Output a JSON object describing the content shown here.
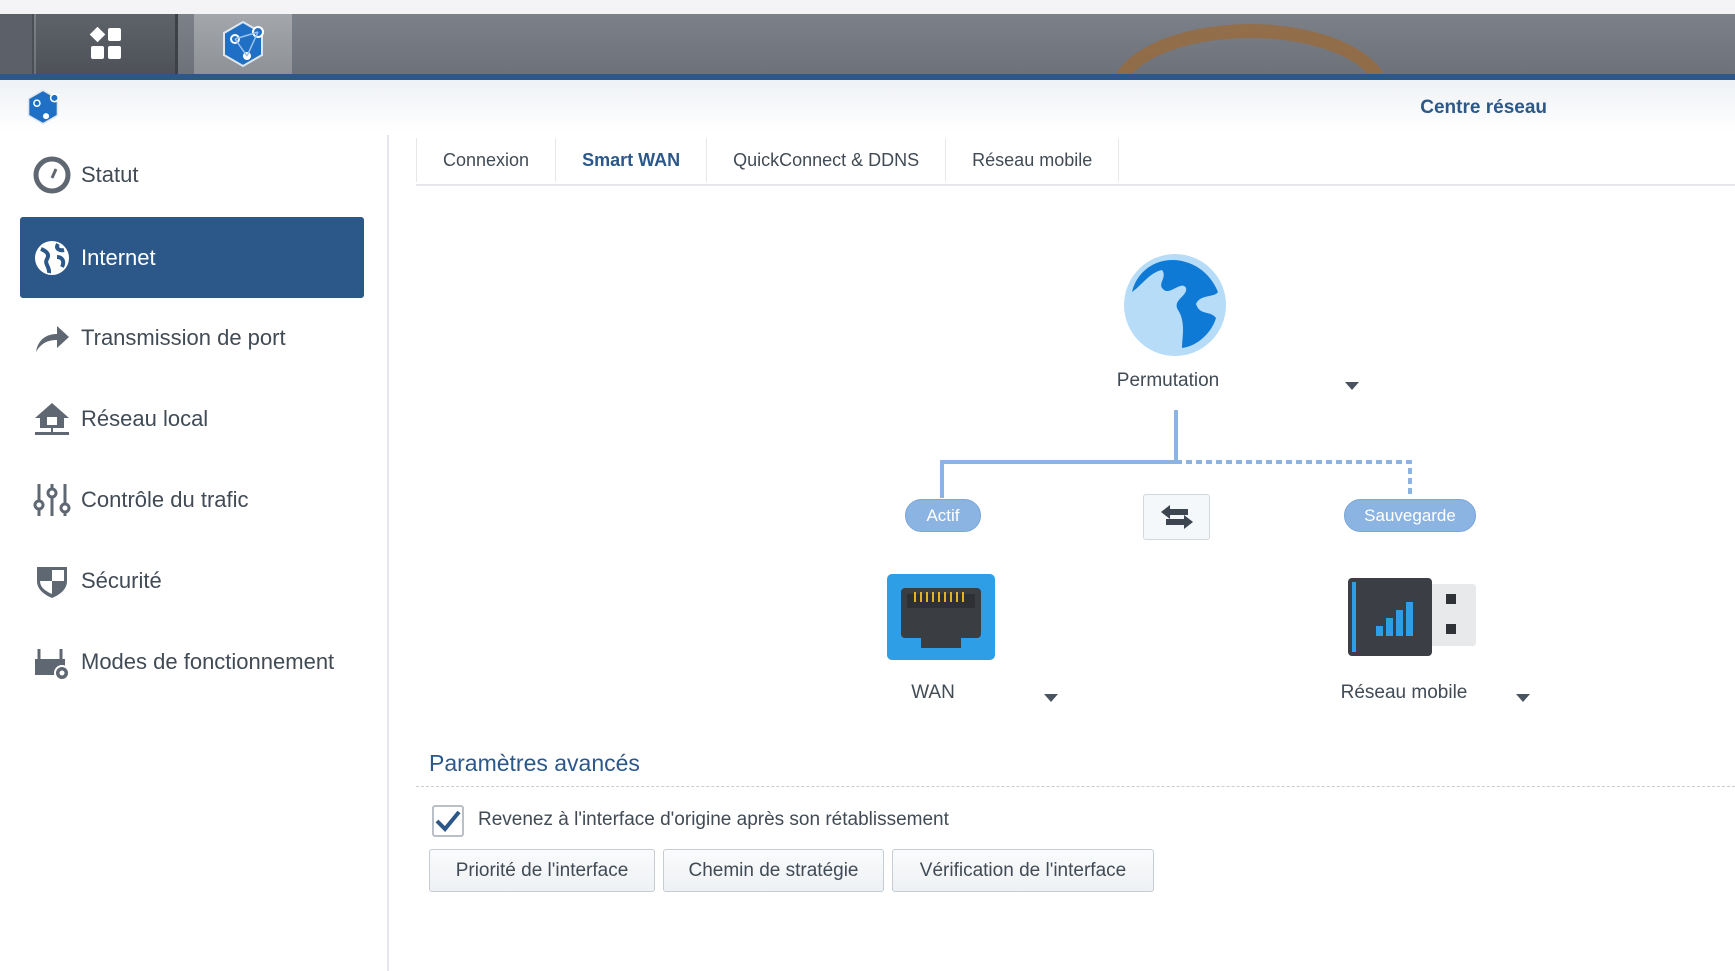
{
  "app": {
    "title": "Centre réseau"
  },
  "sidebar": {
    "items": [
      {
        "label": "Statut",
        "icon": "gauge-icon"
      },
      {
        "label": "Internet",
        "icon": "globe-icon",
        "active": true
      },
      {
        "label": "Transmission de port",
        "icon": "forward-arrow-icon"
      },
      {
        "label": "Réseau local",
        "icon": "home-network-icon"
      },
      {
        "label": "Contrôle du trafic",
        "icon": "sliders-icon"
      },
      {
        "label": "Sécurité",
        "icon": "shield-icon"
      },
      {
        "label": "Modes de fonctionnement",
        "icon": "router-gear-icon"
      }
    ]
  },
  "tabs": [
    {
      "label": "Connexion"
    },
    {
      "label": "Smart WAN",
      "active": true
    },
    {
      "label": "QuickConnect & DDNS"
    },
    {
      "label": "Réseau mobile"
    }
  ],
  "smart_wan": {
    "mode": "Permutation",
    "active_badge": "Actif",
    "backup_badge": "Sauvegarde",
    "primary": "WAN",
    "secondary": "Réseau mobile"
  },
  "advanced": {
    "title": "Paramètres avancés",
    "checkbox_label": "Revenez à l'interface d'origine après son rétablissement",
    "checkbox_checked": true,
    "buttons": [
      "Priorité de l'interface",
      "Chemin de stratégie",
      "Vérification de l'interface"
    ]
  },
  "colors": {
    "accent": "#2c5889",
    "badge": "#8cb4e2"
  }
}
